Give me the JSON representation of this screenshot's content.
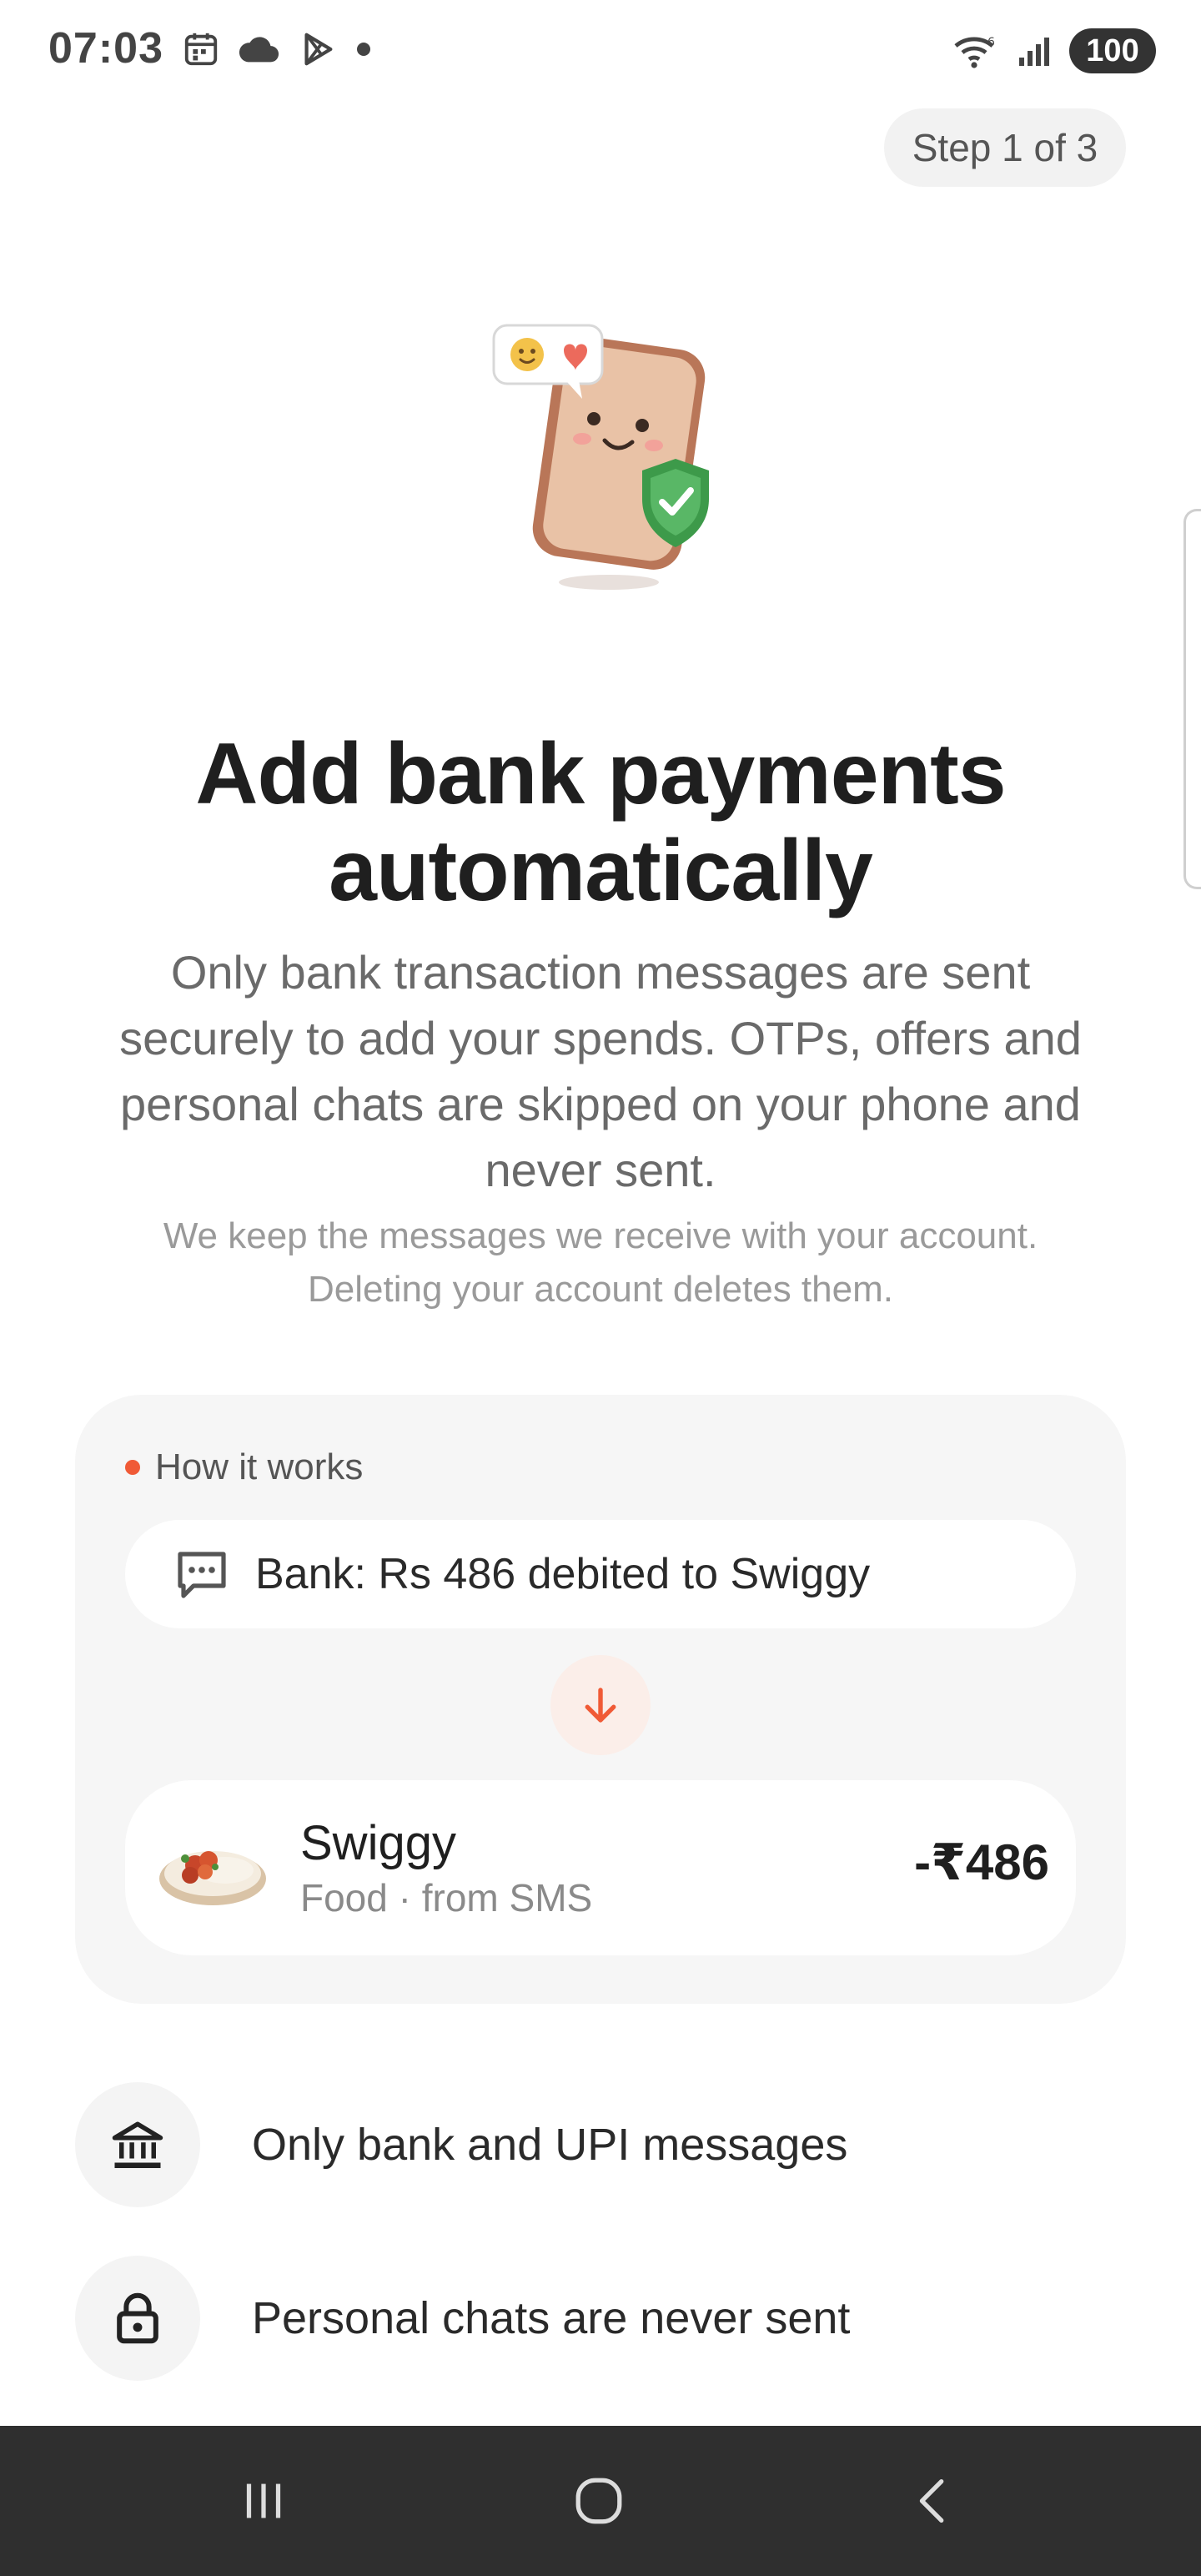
{
  "status_bar": {
    "time": "07:03",
    "battery": "100",
    "icons": [
      "calendar-icon",
      "cloud-icon",
      "play-store-icon",
      "dot-icon",
      "wifi-icon",
      "signal-icon"
    ]
  },
  "header": {
    "step_label": "Step 1 of 3"
  },
  "hero": {
    "illustration": "phone-shield-illustration"
  },
  "content": {
    "title_line1": "Add bank payments",
    "title_line2": "automatically",
    "description_line1": "Only bank transaction messages are sent",
    "description_line2": "securely to add your spends. OTPs, offers and",
    "description_line3": "personal chats are skipped on your phone and",
    "description_line4": "never sent.",
    "fine_print_line1": "We keep the messages we receive with your account.",
    "fine_print_line2": "Deleting your account deletes them."
  },
  "how_it_works": {
    "label": "How it works",
    "accent_color": "#f05a36",
    "sms_text": "Bank: Rs 486 debited to Swiggy",
    "transaction": {
      "merchant": "Swiggy",
      "subtitle": "Food · from SMS",
      "amount": "-₹486"
    }
  },
  "features": [
    {
      "icon": "bank-icon",
      "text": "Only bank and UPI messages"
    },
    {
      "icon": "lock-icon",
      "text": "Personal chats are never sent"
    }
  ],
  "nav_bar": {
    "buttons": [
      "recent-apps-button",
      "home-button",
      "back-button"
    ]
  }
}
